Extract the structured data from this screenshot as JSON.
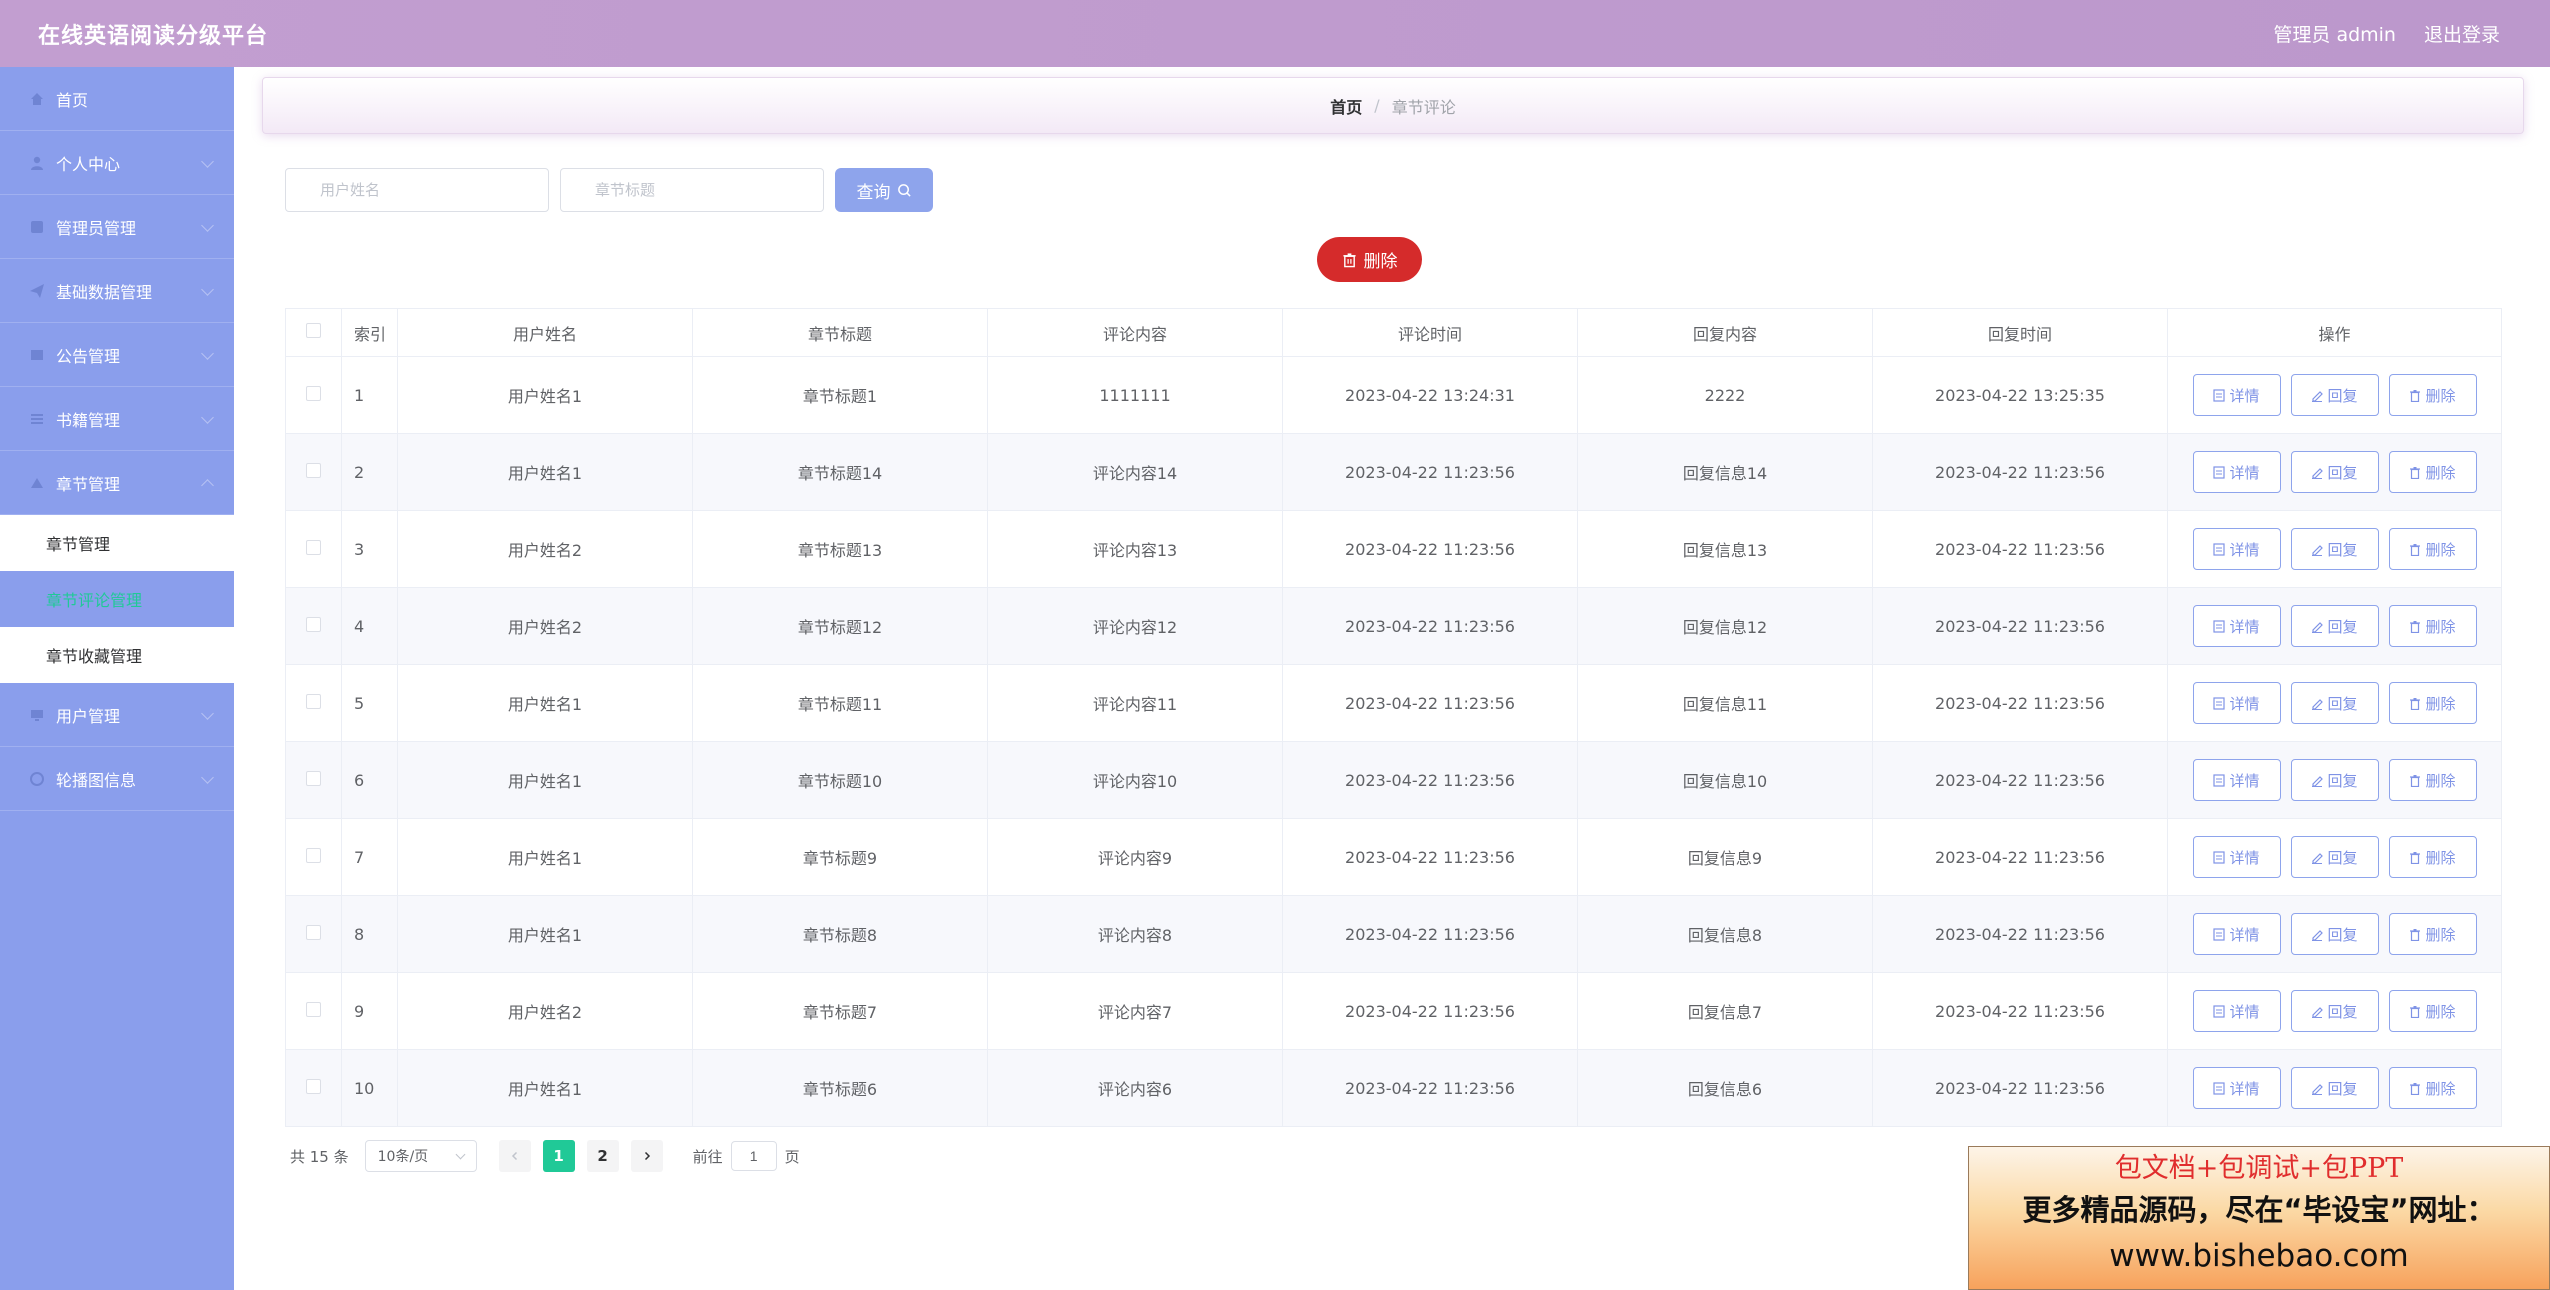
{
  "header": {
    "title": "在线英语阅读分级平台",
    "admin_label": "管理员 admin",
    "logout_label": "退出登录"
  },
  "sidebar": {
    "items": [
      {
        "label": "首页",
        "icon": "home-icon"
      },
      {
        "label": "个人中心",
        "icon": "user-icon"
      },
      {
        "label": "管理员管理",
        "icon": "admin-icon"
      },
      {
        "label": "基础数据管理",
        "icon": "paper-plane-icon"
      },
      {
        "label": "公告管理",
        "icon": "notice-icon"
      },
      {
        "label": "书籍管理",
        "icon": "list-icon"
      },
      {
        "label": "章节管理",
        "icon": "chapter-icon"
      }
    ],
    "sub_items": [
      {
        "label": "章节管理"
      },
      {
        "label": "章节评论管理"
      },
      {
        "label": "章节收藏管理"
      }
    ],
    "bottom_items": [
      {
        "label": "用户管理",
        "icon": "monitor-icon"
      },
      {
        "label": "轮播图信息",
        "icon": "circle-icon"
      }
    ]
  },
  "breadcrumb": {
    "home": "首页",
    "separator": "/",
    "current": "章节评论"
  },
  "search": {
    "username_placeholder": "用户姓名",
    "chapter_placeholder": "章节标题",
    "query_label": "查询"
  },
  "delete_button": {
    "label": "删除"
  },
  "table": {
    "headers": [
      "索引",
      "用户姓名",
      "章节标题",
      "评论内容",
      "评论时间",
      "回复内容",
      "回复时间",
      "操作"
    ],
    "rows": [
      {
        "index": "1",
        "username": "用户姓名1",
        "chapter": "章节标题1",
        "comment": "1111111",
        "comment_time": "2023-04-22 13:24:31",
        "reply": "2222",
        "reply_time": "2023-04-22 13:25:35"
      },
      {
        "index": "2",
        "username": "用户姓名1",
        "chapter": "章节标题14",
        "comment": "评论内容14",
        "comment_time": "2023-04-22 11:23:56",
        "reply": "回复信息14",
        "reply_time": "2023-04-22 11:23:56"
      },
      {
        "index": "3",
        "username": "用户姓名2",
        "chapter": "章节标题13",
        "comment": "评论内容13",
        "comment_time": "2023-04-22 11:23:56",
        "reply": "回复信息13",
        "reply_time": "2023-04-22 11:23:56"
      },
      {
        "index": "4",
        "username": "用户姓名2",
        "chapter": "章节标题12",
        "comment": "评论内容12",
        "comment_time": "2023-04-22 11:23:56",
        "reply": "回复信息12",
        "reply_time": "2023-04-22 11:23:56"
      },
      {
        "index": "5",
        "username": "用户姓名1",
        "chapter": "章节标题11",
        "comment": "评论内容11",
        "comment_time": "2023-04-22 11:23:56",
        "reply": "回复信息11",
        "reply_time": "2023-04-22 11:23:56"
      },
      {
        "index": "6",
        "username": "用户姓名1",
        "chapter": "章节标题10",
        "comment": "评论内容10",
        "comment_time": "2023-04-22 11:23:56",
        "reply": "回复信息10",
        "reply_time": "2023-04-22 11:23:56"
      },
      {
        "index": "7",
        "username": "用户姓名1",
        "chapter": "章节标题9",
        "comment": "评论内容9",
        "comment_time": "2023-04-22 11:23:56",
        "reply": "回复信息9",
        "reply_time": "2023-04-22 11:23:56"
      },
      {
        "index": "8",
        "username": "用户姓名1",
        "chapter": "章节标题8",
        "comment": "评论内容8",
        "comment_time": "2023-04-22 11:23:56",
        "reply": "回复信息8",
        "reply_time": "2023-04-22 11:23:56"
      },
      {
        "index": "9",
        "username": "用户姓名2",
        "chapter": "章节标题7",
        "comment": "评论内容7",
        "comment_time": "2023-04-22 11:23:56",
        "reply": "回复信息7",
        "reply_time": "2023-04-22 11:23:56"
      },
      {
        "index": "10",
        "username": "用户姓名1",
        "chapter": "章节标题6",
        "comment": "评论内容6",
        "comment_time": "2023-04-22 11:23:56",
        "reply": "回复信息6",
        "reply_time": "2023-04-22 11:23:56"
      }
    ],
    "row_actions": {
      "detail": "详情",
      "reply": "回复",
      "delete": "删除"
    }
  },
  "pagination": {
    "total": "共 15 条",
    "page_size": "10条/页",
    "pages": [
      "1",
      "2"
    ],
    "current_page": "1",
    "goto_prefix": "前往",
    "goto_value": "1",
    "goto_suffix": "页"
  },
  "ad_banner": {
    "line1": "包文档+包调试+包PPT",
    "line2": "更多精品源码，尽在“毕设宝”网址：",
    "line3": "www.bishebao.com"
  },
  "colors": {
    "header": "#c29ed0",
    "sidebar": "#8a9eec",
    "accent": "#20c997",
    "danger": "#d52b2b",
    "primary_btn": "#8ea4ec"
  }
}
